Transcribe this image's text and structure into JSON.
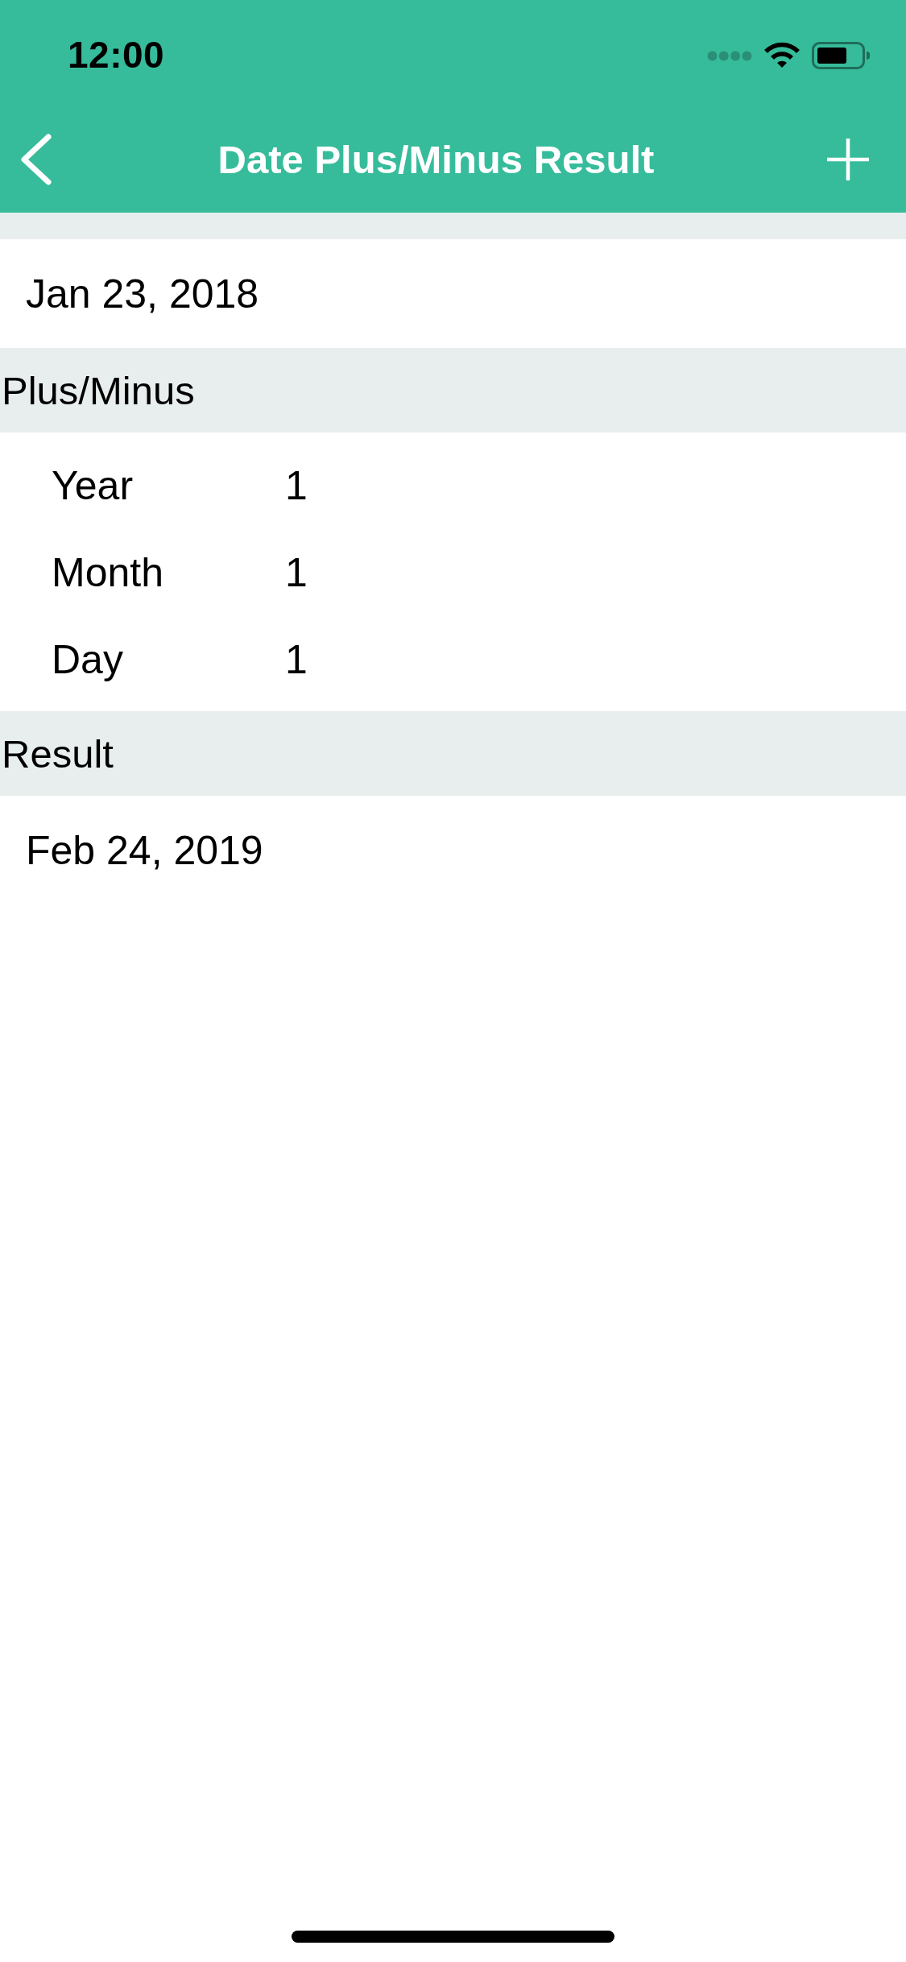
{
  "status_bar": {
    "time": "12:00"
  },
  "nav_bar": {
    "title": "Date Plus/Minus Result"
  },
  "start_date": {
    "value": "Jan 23, 2018"
  },
  "plus_minus": {
    "header": "Plus/Minus",
    "rows": [
      {
        "label": "Year",
        "value": "1"
      },
      {
        "label": "Month",
        "value": "1"
      },
      {
        "label": "Day",
        "value": "1"
      }
    ]
  },
  "result": {
    "header": "Result",
    "value": "Feb 24, 2019"
  }
}
